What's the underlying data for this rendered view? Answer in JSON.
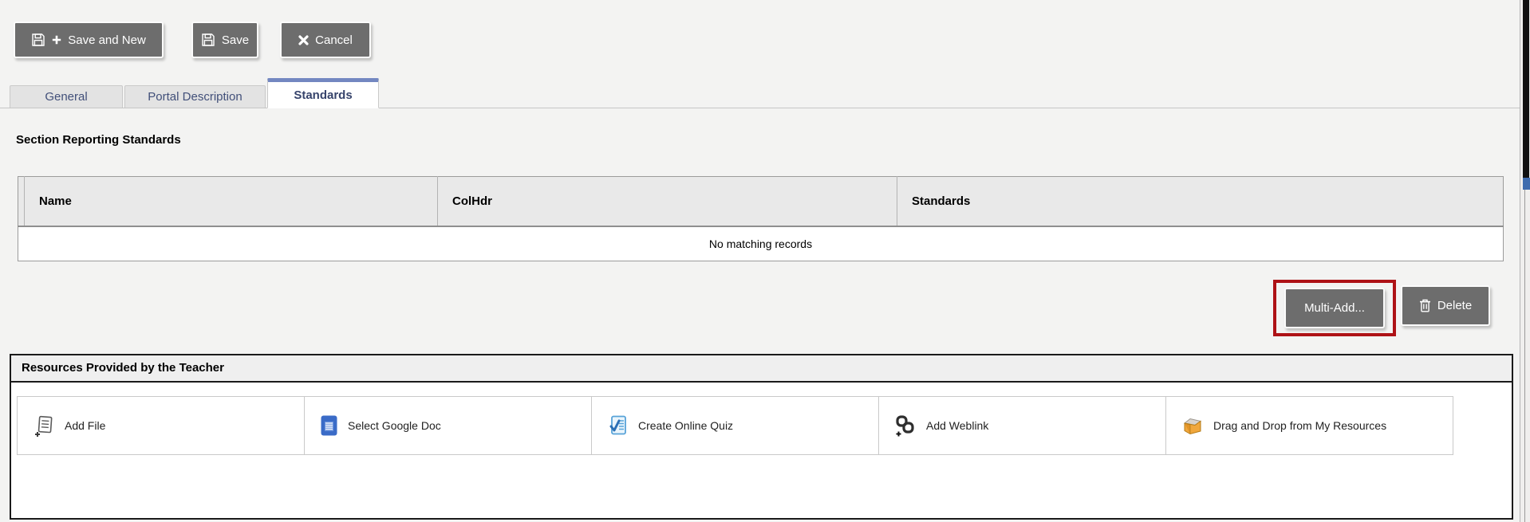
{
  "toolbar": {
    "save_and_new": "Save and New",
    "save": "Save",
    "cancel": "Cancel"
  },
  "tabs": [
    {
      "label": "General",
      "active": false
    },
    {
      "label": "Portal Description",
      "active": false
    },
    {
      "label": "Standards",
      "active": true
    }
  ],
  "section_title": "Section Reporting Standards",
  "standards_table": {
    "columns": [
      "Name",
      "ColHdr",
      "Standards"
    ],
    "rows": [],
    "empty_message": "No matching records"
  },
  "actions": {
    "multi_add": "Multi-Add...",
    "delete": "Delete"
  },
  "resources": {
    "title": "Resources Provided by the Teacher",
    "items": [
      {
        "label": "Add File",
        "icon": "add-file-icon"
      },
      {
        "label": "Select Google Doc",
        "icon": "google-doc-icon"
      },
      {
        "label": "Create Online Quiz",
        "icon": "online-quiz-icon"
      },
      {
        "label": "Add Weblink",
        "icon": "add-weblink-icon"
      },
      {
        "label": "Drag and Drop from My Resources",
        "icon": "my-resources-icon"
      }
    ]
  },
  "colors": {
    "button_gray": "#6d6d6d",
    "tab_accent_blue": "#7387c1",
    "highlight_red": "#ae1216",
    "scrollbar_blue": "#3f6cae"
  }
}
